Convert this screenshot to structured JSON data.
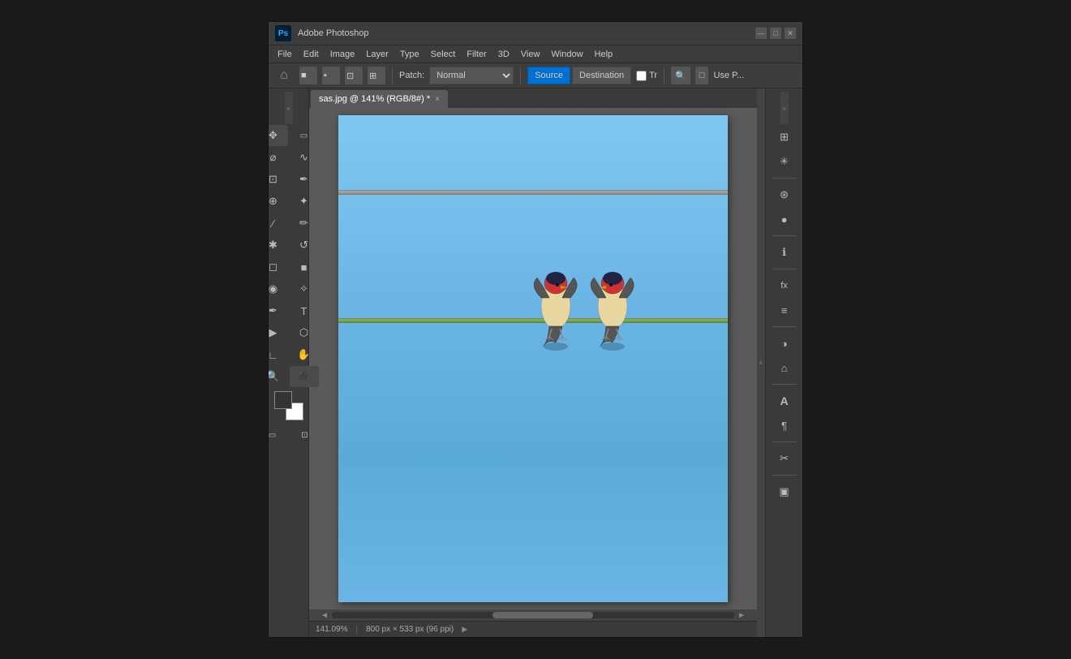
{
  "window": {
    "title": "Adobe Photoshop",
    "ps_logo": "Ps"
  },
  "title_bar": {
    "controls": {
      "minimize": "—",
      "maximize": "□",
      "close": "✕"
    }
  },
  "menu": {
    "items": [
      "File",
      "Edit",
      "Image",
      "Layer",
      "Type",
      "Select",
      "Filter",
      "3D",
      "View",
      "Window",
      "Help"
    ]
  },
  "options_bar": {
    "patch_label": "Patch:",
    "mode_value": "Normal",
    "source_btn": "Source",
    "destination_btn": "Destination",
    "transform_label": "Tr",
    "use_pattern_label": "Use P..."
  },
  "tab": {
    "filename": "sas.jpg @ 141% (RGB/8#) *",
    "close": "×"
  },
  "status_bar": {
    "zoom": "141.09%",
    "dimensions": "800 px × 533 px (96 ppi)"
  },
  "toolbar": {
    "tools": [
      {
        "name": "move-tool",
        "icon": "✥"
      },
      {
        "name": "marquee-tool",
        "icon": "▭"
      },
      {
        "name": "lasso-tool",
        "icon": "⌀"
      },
      {
        "name": "magic-wand-tool",
        "icon": "✲"
      },
      {
        "name": "crop-tool",
        "icon": "⊡"
      },
      {
        "name": "eyedropper-tool",
        "icon": "✏"
      },
      {
        "name": "healing-brush-tool",
        "icon": "⊕"
      },
      {
        "name": "brush-tool",
        "icon": "∕"
      },
      {
        "name": "stamp-tool",
        "icon": "✱"
      },
      {
        "name": "history-brush-tool",
        "icon": "↺"
      },
      {
        "name": "eraser-tool",
        "icon": "◻"
      },
      {
        "name": "gradient-tool",
        "icon": "■"
      },
      {
        "name": "blur-tool",
        "icon": "◉"
      },
      {
        "name": "dodge-tool",
        "icon": "◎"
      },
      {
        "name": "pen-tool",
        "icon": "✒"
      },
      {
        "name": "text-tool",
        "icon": "T"
      },
      {
        "name": "path-select-tool",
        "icon": "▶"
      },
      {
        "name": "shape-tool",
        "icon": "∟"
      },
      {
        "name": "hand-tool",
        "icon": "✋"
      },
      {
        "name": "zoom-tool",
        "icon": "⊕"
      },
      {
        "name": "selection-brush",
        "icon": "⬛"
      }
    ]
  },
  "right_panel": {
    "icons": [
      {
        "name": "grid-icon",
        "icon": "⊞"
      },
      {
        "name": "snowflake-icon",
        "icon": "✳"
      },
      {
        "name": "circle-icon",
        "icon": "●"
      },
      {
        "name": "info-icon",
        "icon": "ℹ"
      },
      {
        "name": "fx-icon",
        "icon": "fx"
      },
      {
        "name": "layers-icon",
        "icon": "≡"
      },
      {
        "name": "adjustment-icon",
        "icon": "◑"
      },
      {
        "name": "brush-settings-icon",
        "icon": "⌂"
      },
      {
        "name": "char-icon",
        "icon": "A"
      },
      {
        "name": "para-icon",
        "icon": "¶"
      },
      {
        "name": "tools-icon",
        "icon": "✂"
      },
      {
        "name": "info2-icon",
        "icon": "▣"
      }
    ]
  },
  "colors": {
    "background": "#2b2b2b",
    "toolbar_bg": "#3a3a3a",
    "canvas_bg": "#5a5a5a",
    "sky_blue": "#7ec8f0",
    "wire_color": "#888888",
    "active_btn": "#0070d0"
  }
}
